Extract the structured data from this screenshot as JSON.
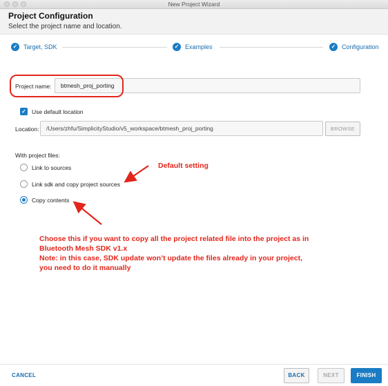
{
  "window": {
    "title": "New Project Wizard"
  },
  "header": {
    "title": "Project Configuration",
    "subtitle": "Select the project name and location."
  },
  "steps": [
    {
      "label": "Target, SDK",
      "state": "complete"
    },
    {
      "label": "Examples",
      "state": "complete"
    },
    {
      "label": "Configuration",
      "state": "complete"
    }
  ],
  "form": {
    "project_name_label": "Project name:",
    "project_name_value": "btmesh_proj_porting",
    "use_default_location_label": "Use default location",
    "use_default_location_checked": true,
    "location_label": "Location:",
    "location_value": "/Users/zhfu/SimplicityStudio/v5_workspace/btmesh_proj_porting",
    "browse_label": "BROWSE",
    "project_files_label": "With project files:",
    "options": [
      {
        "label": "Link to sources",
        "selected": false
      },
      {
        "label": "Link sdk and copy project sources",
        "selected": false
      },
      {
        "label": "Copy contents",
        "selected": true
      }
    ]
  },
  "annotations": {
    "default_setting": "Default setting",
    "note_lines": [
      "Choose this if you want to copy all the project related file into the project as in",
      "Bluetooth Mesh SDK v1.x",
      "Note: in this case, SDK update won’t update the files already in your project,",
      "you need to do it manually"
    ],
    "color": "#e2261b"
  },
  "footer": {
    "cancel_label": "CANCEL",
    "back_label": "BACK",
    "next_label": "NEXT",
    "finish_label": "FINISH"
  },
  "colors": {
    "accent": "#1a7cc4",
    "annotation": "#e2261b"
  }
}
